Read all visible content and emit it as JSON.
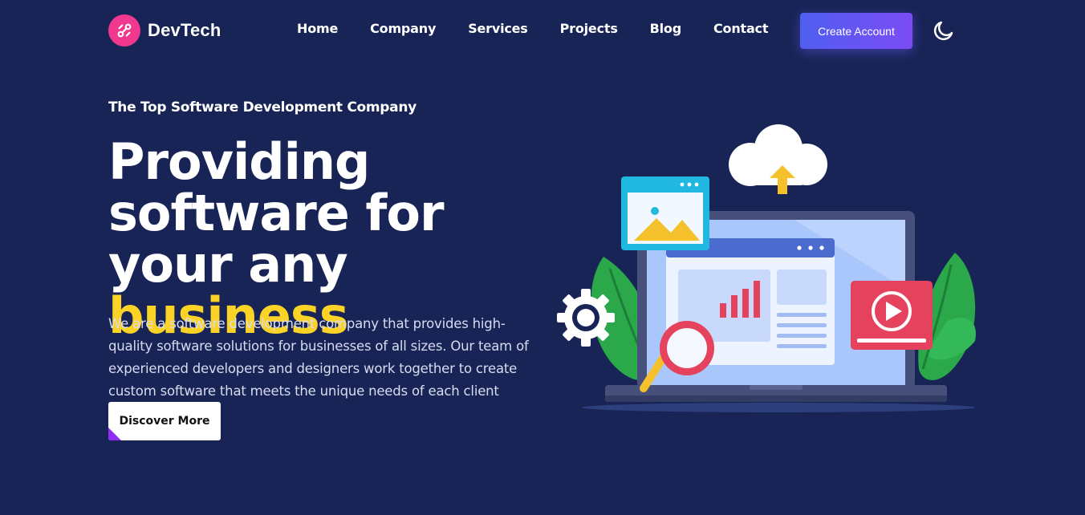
{
  "brand": {
    "name": "DevTech",
    "icon": "link-icon",
    "accent": "#f0388f"
  },
  "nav": {
    "items": [
      {
        "label": "Home"
      },
      {
        "label": "Company"
      },
      {
        "label": "Services"
      },
      {
        "label": "Projects"
      },
      {
        "label": "Blog"
      },
      {
        "label": "Contact"
      }
    ]
  },
  "header": {
    "cta_label": "Create Account",
    "theme_icon": "moon-icon"
  },
  "hero": {
    "eyebrow": "The Top Software Development Company",
    "headline_part1": "Providing software for your any ",
    "headline_highlight": "business",
    "highlight_color": "#fbd326",
    "description": "We are a software development company that provides high-quality software solutions for businesses of all sizes. Our team of experienced developers and designers work together to create custom software that meets the unique needs of each client",
    "button_label": "Discover More"
  },
  "colors": {
    "background": "#182456",
    "button_gradient_start": "#4f5ff0",
    "button_gradient_end": "#7c4cf6"
  }
}
